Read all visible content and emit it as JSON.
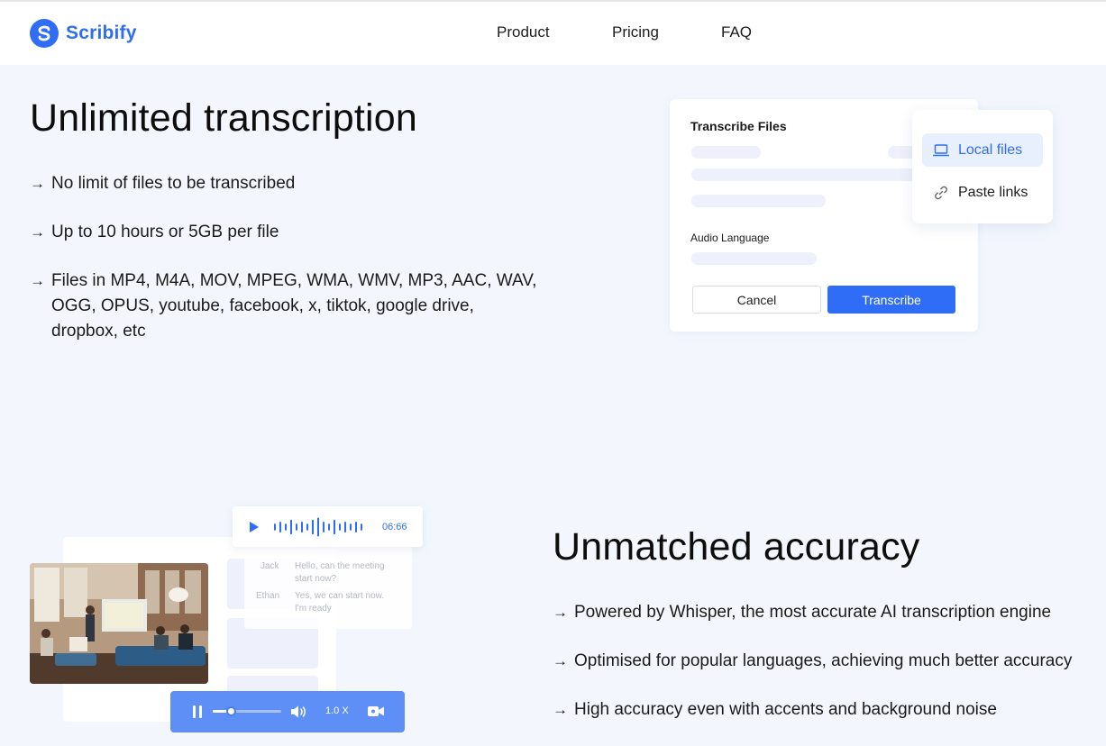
{
  "brand": {
    "name": "Scribify",
    "color": "#2f6df6"
  },
  "nav": {
    "items": [
      "Product",
      "Pricing",
      "FAQ"
    ]
  },
  "section1": {
    "title": "Unlimited transcription",
    "features": [
      "No limit of files to be transcribed",
      "Up to 10 hours or 5GB per file",
      [
        "Files in MP4, M4A, MOV, MPEG, WMA, WMV, MP3, AAC, WAV,",
        "OGG, OPUS, youtube, facebook, x, tiktok, google drive,",
        "dropbox, etc"
      ]
    ],
    "arrow": "→"
  },
  "transcribe_card": {
    "title": "Transcribe Files",
    "audio_language_label": "Audio Language",
    "cancel_label": "Cancel",
    "transcribe_label": "Transcribe",
    "source_menu": {
      "local_files": "Local files",
      "paste_links": "Paste links",
      "icons": [
        "laptop-icon",
        "link-icon"
      ]
    }
  },
  "section2": {
    "title": "Unmatched accuracy",
    "features": [
      "Powered by Whisper, the most accurate AI transcription engine",
      "Optimised for popular languages, achieving much better accuracy",
      "High accuracy even with accents and background noise"
    ]
  },
  "illustration": {
    "audio_time": "06:66",
    "chat": [
      {
        "speaker": "Jack",
        "lines": [
          "Hello, can the meeting",
          "start now?"
        ]
      },
      {
        "speaker": "Ethan",
        "lines": [
          "Yes, we can start now.",
          "I'm ready"
        ]
      }
    ],
    "player_speed": "1.0 X",
    "player_progress": 0.26,
    "waveform_levels": [
      0.35,
      0.55,
      0.35,
      0.75,
      0.35,
      0.55,
      0.35,
      0.75,
      0.95,
      0.55,
      0.35,
      0.75,
      0.35,
      0.55,
      0.35,
      0.55,
      0.35
    ]
  }
}
